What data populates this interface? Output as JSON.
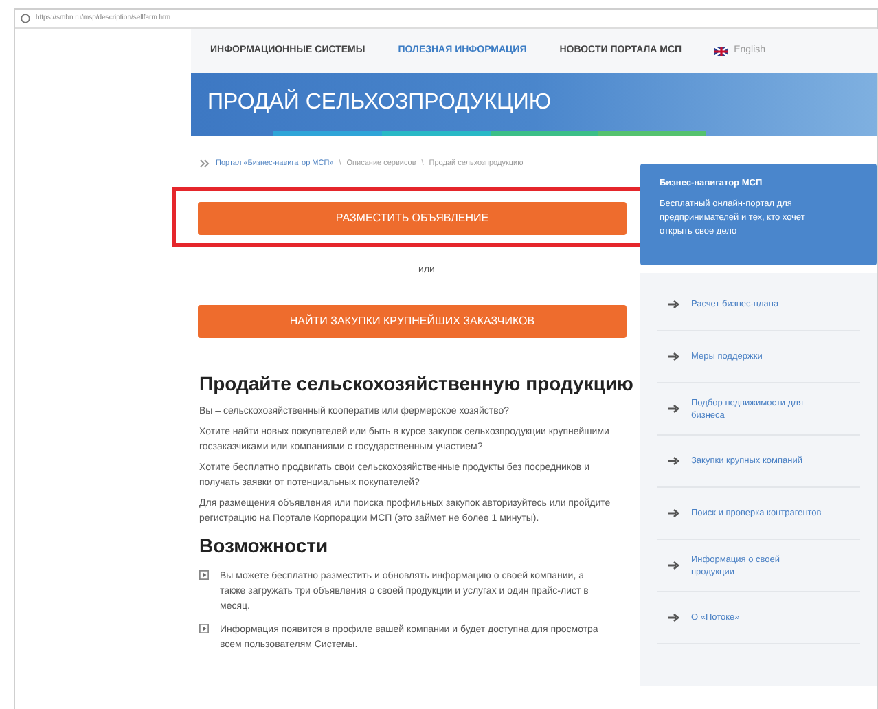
{
  "browser": {
    "url": "https://smbn.ru/msp/description/sellfarm.htm"
  },
  "nav": [
    {
      "label": "ИНФОРМАЦИОННЫЕ СИСТЕМЫ",
      "selected": false
    },
    {
      "label": "ПОЛЕЗНАЯ ИНФОРМАЦИЯ",
      "selected": true
    },
    {
      "label": "НОВОСТИ ПОРТАЛА МСП",
      "selected": false
    }
  ],
  "language": "English",
  "banner": {
    "title": "ПРОДАЙ СЕЛЬХОЗПРОДУКЦИЮ"
  },
  "breadcrumb_separator": "\\",
  "breadcrumb": [
    "Портал «Бизнес-навигатор МСП»",
    "Описание сервисов",
    "Продай сельхозпродукцию"
  ],
  "buttons": [
    {
      "label": "РАЗМЕСТИТЬ ОБЪЯВЛЕНИЕ",
      "highlighted": true
    },
    {
      "label": "НАЙТИ ЗАКУПКИ КРУПНЕЙШИХ ЗАКАЗЧИКОВ",
      "highlighted": false
    }
  ],
  "or_text": "или",
  "heading": "Продайте сельскохозяйственную продукцию",
  "paragraphs": [
    "Вы – сельскохозяйственный кооператив или фермерское хозяйство?",
    "Хотите найти новых покупателей или быть в курсе закупок сельхозпродукции крупнейшими госзаказчиками или компаниями с государственным участием?",
    "Хотите бесплатно продвигать свои сельскохозяйственные продукты без посредников и получать заявки от потенциальных покупателей?",
    "Для размещения объявления или поиска профильных закупок авторизуйтесь или пройдите регистрацию на Портале Корпорации МСП (это займет не более 1 минуты)."
  ],
  "features_heading": "Возможности",
  "features": [
    "Вы можете бесплатно разместить и обновлять информацию о своей компании, а также загружать три объявления о своей продукции и услугах и один прайс-лист в месяц.",
    "Информация появится в профиле вашей компании и будет доступна для просмотра всем пользователям Системы."
  ],
  "sidebar": {
    "card_title": "Бизнес-навигатор МСП",
    "card_text": "Бесплатный онлайн-портал для предпринимателей и тех, кто хочет открыть свое дело",
    "links": [
      "Расчет бизнес-плана",
      "Меры поддержки",
      "Подбор недвижимости для бизнеса",
      "Закупки крупных компаний",
      "Поиск и проверка контрагентов",
      "Информация о своей продукции",
      "О «Потоке»"
    ]
  }
}
